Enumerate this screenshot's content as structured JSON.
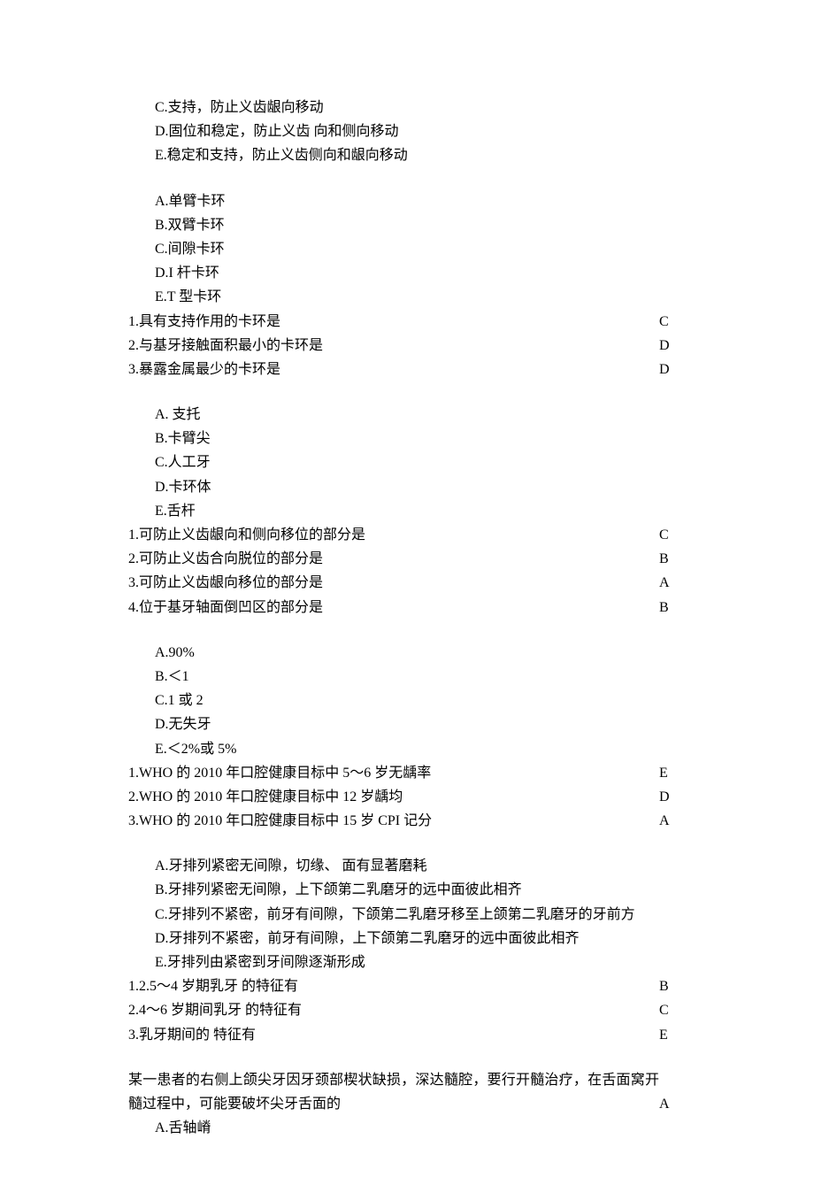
{
  "block1": {
    "opts": [
      "C.支持，防止义齿龈向移动",
      "D.固位和稳定，防止义齿 向和侧向移动",
      "E.稳定和支持，防止义齿侧向和龈向移动"
    ]
  },
  "block2": {
    "opts": [
      "A.单臂卡环",
      "B.双臂卡环",
      "C.间隙卡环",
      "D.I 杆卡环",
      "E.T 型卡环"
    ],
    "qs": [
      {
        "t": "1.具有支持作用的卡环是",
        "a": "C"
      },
      {
        "t": "2.与基牙接触面积最小的卡环是",
        "a": "D"
      },
      {
        "t": "3.暴露金属最少的卡环是",
        "a": "D"
      }
    ]
  },
  "block3": {
    "opts": [
      "A.  支托",
      "B.卡臂尖",
      "C.人工牙",
      "D.卡环体",
      "E.舌杆"
    ],
    "qs": [
      {
        "t": "1.可防止义齿龈向和侧向移位的部分是",
        "a": "C"
      },
      {
        "t": "2.可防止义齿合向脱位的部分是",
        "a": "B"
      },
      {
        "t": "3.可防止义齿龈向移位的部分是",
        "a": "A"
      },
      {
        "t": "4.位于基牙轴面倒凹区的部分是",
        "a": "B"
      }
    ]
  },
  "block4": {
    "opts": [
      "A.90%",
      "B.＜1",
      "C.1 或 2",
      "D.无失牙",
      "E.＜2%或 5%"
    ],
    "qs": [
      {
        "t": "1.WHO 的 2010 年口腔健康目标中 5～6 岁无龋率",
        "a": "E"
      },
      {
        "t": "2.WHO 的 2010 年口腔健康目标中 12 岁龋均",
        "a": "D"
      },
      {
        "t": "3.WHO 的 2010 年口腔健康目标中 15 岁 CPI 记分",
        "a": "A"
      }
    ]
  },
  "block5": {
    "opts": [
      "A.牙排列紧密无间隙，切缘、  面有显著磨耗",
      "B.牙排列紧密无间隙，上下颌第二乳磨牙的远中面彼此相齐",
      "C.牙排列不紧密，前牙有间隙，下颌第二乳磨牙移至上颌第二乳磨牙的牙前方",
      "D.牙排列不紧密，前牙有间隙，上下颌第二乳磨牙的远中面彼此相齐",
      "E.牙排列由紧密到牙间隙逐渐形成"
    ],
    "qs": [
      {
        "t": "1.2.5～4 岁期乳牙 的特征有",
        "a": "B"
      },
      {
        "t": "2.4～6 岁期间乳牙 的特征有",
        "a": "C"
      },
      {
        "t": "3.乳牙期间的 特征有",
        "a": "E"
      }
    ]
  },
  "block6": {
    "intro": "某一患者的右侧上颌尖牙因牙颈部楔状缺损，深达髓腔，要行开髓治疗，在舌面窝开髓过程中，可能要破坏尖牙舌面的",
    "intro_ans": "A",
    "opts": [
      "A.舌轴嵴"
    ]
  }
}
